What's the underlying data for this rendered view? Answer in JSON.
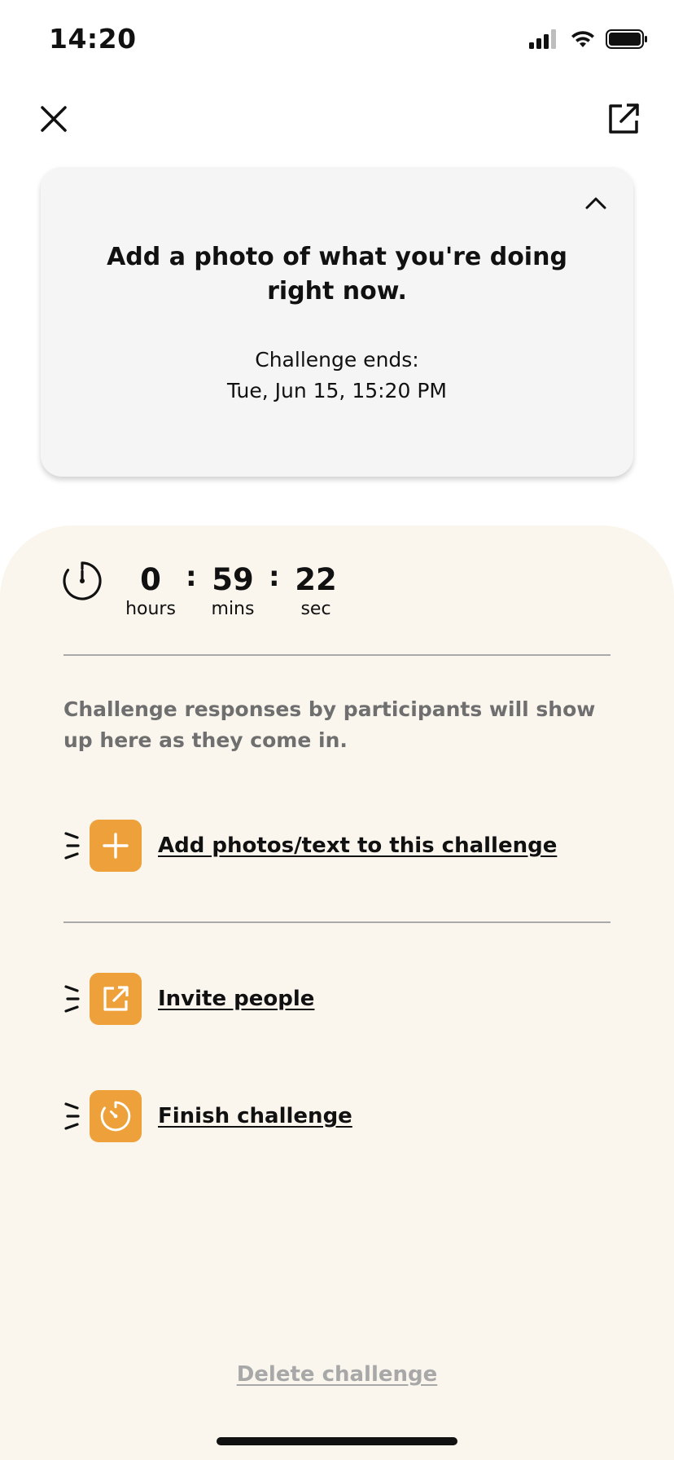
{
  "status_bar": {
    "time": "14:20",
    "icons": [
      "signal-icon",
      "wifi-icon",
      "battery-icon"
    ]
  },
  "header": {
    "close_icon": "close-icon",
    "share_icon": "share-icon"
  },
  "prompt_card": {
    "prompt": "Add a photo of what you're doing right now.",
    "ends_label": "Challenge ends:",
    "ends_date": "Tue, Jun 15, 15:20 PM",
    "collapse_icon": "chevron-up-icon"
  },
  "countdown": {
    "hours_value": "0",
    "hours_label": "hours",
    "mins_value": "59",
    "mins_label": "mins",
    "secs_value": "22",
    "secs_label": "sec",
    "separator": ":"
  },
  "info_text": "Challenge responses by participants will show up here as they come in.",
  "actions": [
    {
      "label": "Add photos/text to this challenge",
      "icon": "plus-icon"
    },
    {
      "label": "Invite people",
      "icon": "external-link-icon"
    },
    {
      "label": "Finish challenge",
      "icon": "timer-icon"
    }
  ],
  "delete_label": "Delete challenge",
  "colors": {
    "accent": "#eea13a",
    "panel_bg": "#faf6ee",
    "card_bg": "#f5f5f5",
    "muted_text": "#6f6f6f",
    "delete_text": "#a8a8a8"
  }
}
